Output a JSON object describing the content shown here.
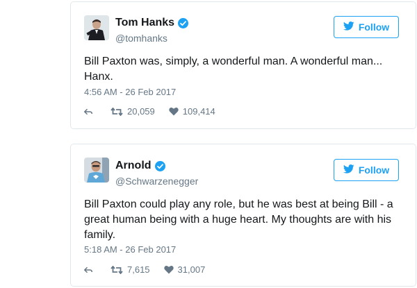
{
  "tweets": [
    {
      "display_name": "Tom Hanks",
      "handle": "@tomhanks",
      "verified": true,
      "follow_label": "Follow",
      "text": "Bill Paxton was, simply, a wonderful man. A wonderful man... Hanx.",
      "timestamp": "4:56 AM - 26 Feb 2017",
      "retweets": "20,059",
      "likes": "109,414"
    },
    {
      "display_name": "Arnold",
      "handle": "@Schwarzenegger",
      "verified": true,
      "follow_label": "Follow",
      "text": "Bill Paxton could play any role, but he was best at being Bill - a great human being with a huge heart. My thoughts are with his family.",
      "timestamp": "5:18 AM - 26 Feb 2017",
      "retweets": "7,615",
      "likes": "31,007"
    }
  ],
  "colors": {
    "accent": "#1da1f2",
    "muted": "#657786",
    "text": "#14171a",
    "border": "#e1e8ed"
  }
}
